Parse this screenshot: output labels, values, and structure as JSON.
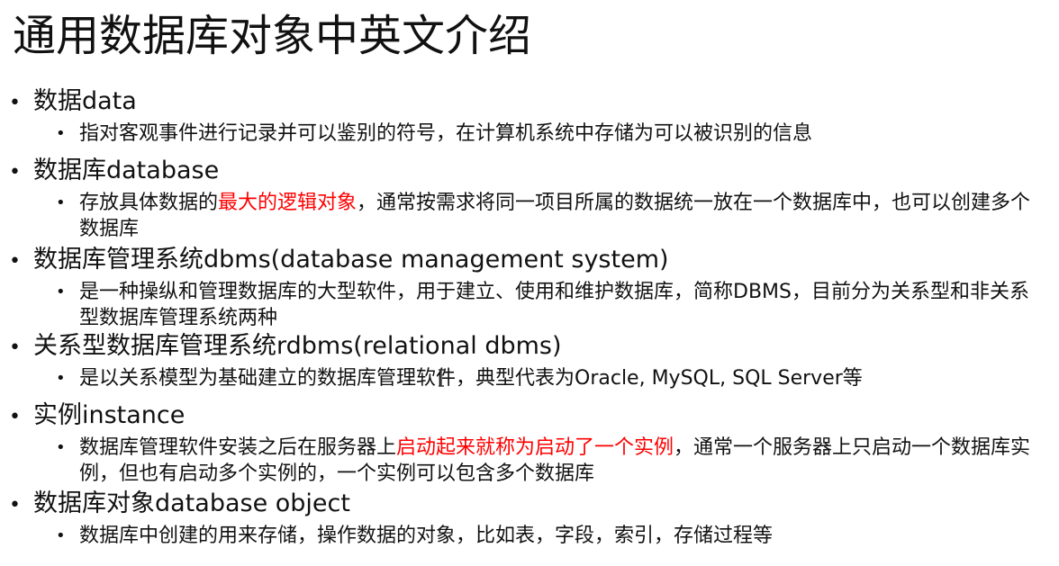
{
  "title": "通用数据库对象中英文介绍",
  "colors": {
    "text": "#111111",
    "highlight": "#ff0000",
    "background": "#ffffff"
  },
  "items": [
    {
      "bullet": "•",
      "heading": "数据data",
      "subbullet": "•",
      "detail": "指对客观事件进行记录并可以鉴别的符号，在计算机系统中存储为可以被识别的信息"
    },
    {
      "bullet": "•",
      "heading": "数据库database",
      "subbullet": "•",
      "detail_prefix": "存放具体数据的",
      "detail_highlight": "最大的逻辑对象",
      "detail_suffix": "，通常按需求将同一项目所属的数据统一放在一个数据库中，也可以创建多个数据库"
    },
    {
      "bullet": "•",
      "heading": "数据库管理系统dbms(database management system)",
      "subbullet": "•",
      "detail": "是一种操纵和管理数据库的大型软件，用于建立、使用和维护数据库，简称DBMS，目前分为关系型和非关系型数据库管理系统两种"
    },
    {
      "bullet": "•",
      "heading": "关系型数据库管理系统rdbms(relational dbms)",
      "subbullet": "•",
      "detail": "是以关系模型为基础建立的数据库管理软件，典型代表为Oracle, MySQL, SQL Server等"
    },
    {
      "bullet": "•",
      "heading": "实例instance",
      "subbullet": "•",
      "detail_prefix": "数据库管理软件安装之后在服务器上",
      "detail_highlight": "启动起来就称为启动了一个实例",
      "detail_suffix": "，通常一个服务器上只启动一个数据库实例，但也有启动多个实例的，一个实例可以包含多个数据库"
    },
    {
      "bullet": "•",
      "heading": "数据库对象database object",
      "subbullet": "•",
      "detail": "数据库中创建的用来存储，操作数据的对象，比如表，字段，索引，存储过程等"
    }
  ]
}
